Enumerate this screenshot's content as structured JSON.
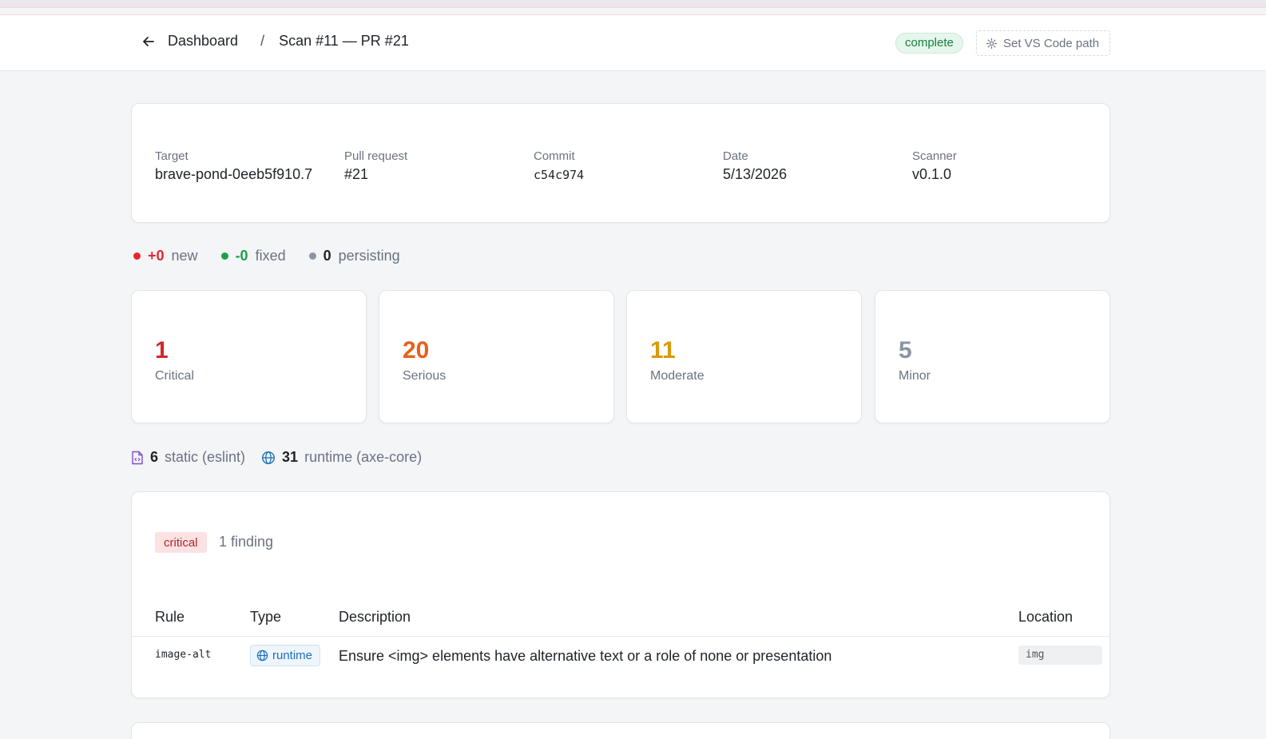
{
  "header": {
    "breadcrumb_root": "Dashboard",
    "breadcrumb_sep": "/",
    "breadcrumb_current": "Scan #11 — PR #21",
    "status": "complete",
    "vscode_button": "Set VS Code path"
  },
  "meta": [
    {
      "label": "Target",
      "value": "brave-pond-0eeb5f910.7"
    },
    {
      "label": "Pull request",
      "value": "#21"
    },
    {
      "label": "Commit",
      "value": "c54c974"
    },
    {
      "label": "Date",
      "value": "5/13/2026"
    },
    {
      "label": "Scanner",
      "value": "v0.1.0"
    }
  ],
  "deltas": [
    {
      "num": "+0",
      "label": "new",
      "color": "#e5262f"
    },
    {
      "num": "-0",
      "label": "fixed",
      "color": "#17a34a"
    },
    {
      "num": "0",
      "label": "persisting",
      "color": "#8a94a3"
    }
  ],
  "severities": [
    {
      "count": "1",
      "label": "Critical",
      "color": "#d4262d"
    },
    {
      "count": "20",
      "label": "Serious",
      "color": "#e8601c"
    },
    {
      "count": "11",
      "label": "Moderate",
      "color": "#d99a0b"
    },
    {
      "count": "5",
      "label": "Minor",
      "color": "#8a94a3"
    }
  ],
  "sources": [
    {
      "num": "6",
      "label": "static (eslint)",
      "icon": "file-code-icon"
    },
    {
      "num": "31",
      "label": "runtime (axe-core)",
      "icon": "globe-icon"
    }
  ],
  "findings": {
    "severity": "critical",
    "count_label": "1 finding",
    "columns": [
      "Rule",
      "Type",
      "Description",
      "Location"
    ],
    "rows": [
      {
        "rule": "image-alt",
        "type": "runtime",
        "description": "Ensure <img> elements have alternative text or a role of none or presentation",
        "location": "img"
      }
    ]
  }
}
